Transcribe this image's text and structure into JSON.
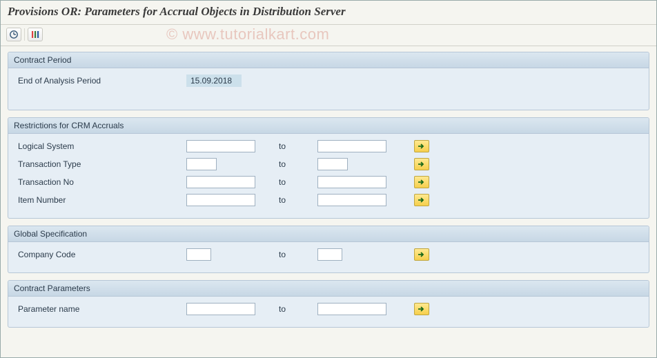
{
  "title": "Provisions OR: Parameters for Accrual Objects in Distribution Server",
  "toolbar": {
    "execute_icon": "execute-icon",
    "variant_icon": "variant-icon"
  },
  "watermark": "© www.tutorialkart.com",
  "groups": {
    "contract_period": {
      "title": "Contract Period",
      "end_label": "End of Analysis Period",
      "end_value": "15.09.2018"
    },
    "crm": {
      "title": "Restrictions for CRM Accruals",
      "to_label": "to",
      "rows": {
        "logical_system": {
          "label": "Logical System",
          "from": "",
          "to": ""
        },
        "transaction_type": {
          "label": "Transaction Type",
          "from": "",
          "to": ""
        },
        "transaction_no": {
          "label": "Transaction No",
          "from": "",
          "to": ""
        },
        "item_number": {
          "label": "Item Number",
          "from": "",
          "to": ""
        }
      }
    },
    "global": {
      "title": "Global Specification",
      "to_label": "to",
      "company_code": {
        "label": "Company Code",
        "from": "",
        "to": ""
      }
    },
    "contract_params": {
      "title": "Contract Parameters",
      "to_label": "to",
      "parameter_name": {
        "label": "Parameter name",
        "from": "",
        "to": ""
      }
    }
  }
}
